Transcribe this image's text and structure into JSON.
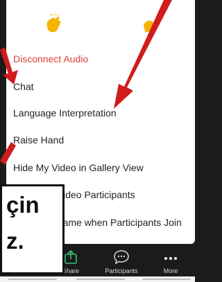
{
  "menu": {
    "items": [
      {
        "label": "Disconnect Audio",
        "style": "danger"
      },
      {
        "label": "Chat",
        "style": "normal"
      },
      {
        "label": "Language Interpretation",
        "style": "normal"
      },
      {
        "label": "Raise Hand",
        "style": "normal"
      },
      {
        "label": "Hide My Video in Gallery View",
        "style": "normal"
      },
      {
        "label": "Hide Non-Video Participants",
        "style": "normal"
      },
      {
        "label": "Show My Name when Participants Join",
        "style": "normal"
      }
    ],
    "reactions": [
      "clap-emoji-icon",
      "thumbs-up-emoji-icon"
    ]
  },
  "toolbar": {
    "items": [
      {
        "label": "Share",
        "icon": "share-icon"
      },
      {
        "label": "Participants",
        "icon": "participants-chat-icon"
      },
      {
        "label": "More",
        "icon": "more-dots-icon"
      }
    ]
  },
  "overlay": {
    "caption_lines": [
      "çin",
      "z."
    ]
  },
  "colors": {
    "danger": "#e0413a",
    "arrow": "#d01c1c",
    "share_green": "#38c172"
  }
}
